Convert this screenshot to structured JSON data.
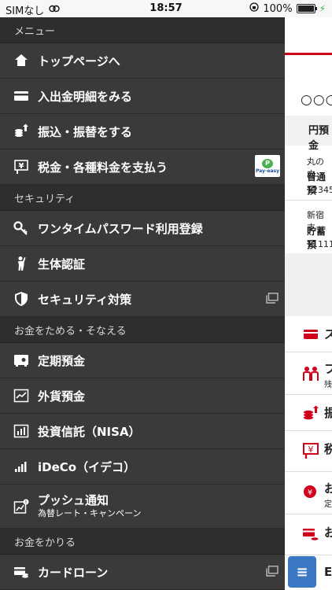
{
  "status": {
    "carrier": "SIMなし",
    "time": "18:57",
    "battery": "100%"
  },
  "menu": {
    "sections": [
      {
        "title": "メニュー",
        "items": [
          {
            "label": "トップページへ",
            "icon": "home-icon"
          },
          {
            "label": "入出金明細をみる",
            "icon": "card-icon"
          },
          {
            "label": "振込・振替をする",
            "icon": "coins-transfer-icon"
          },
          {
            "label": "税金・各種料金を支払う",
            "icon": "payment-slip-icon",
            "badge": "Pay-easy"
          }
        ]
      },
      {
        "title": "セキュリティ",
        "items": [
          {
            "label": "ワンタイムパスワード利用登録",
            "icon": "key-icon"
          },
          {
            "label": "生体認証",
            "icon": "person-icon"
          },
          {
            "label": "セキュリティ対策",
            "icon": "shield-icon",
            "external": true
          }
        ]
      },
      {
        "title": "お金をためる・そなえる",
        "items": [
          {
            "label": "定期預金",
            "icon": "safe-icon"
          },
          {
            "label": "外貨預金",
            "icon": "line-chart-icon"
          },
          {
            "label": "投資信託（NISA）",
            "icon": "bar-chart-icon"
          },
          {
            "label": "iDeCo（イデコ）",
            "icon": "signal-icon"
          },
          {
            "label": "プッシュ通知",
            "sub": "為替レート・キャンペーン",
            "icon": "notification-chart-icon"
          }
        ]
      },
      {
        "title": "お金をかりる",
        "items": [
          {
            "label": "カードローン",
            "icon": "loan-card-icon",
            "external": true
          }
        ]
      }
    ]
  },
  "content": {
    "header_dots": "○○○",
    "tab": "円預金",
    "accounts": [
      {
        "branch": "丸の内",
        "type": "普通預",
        "number": "12345"
      },
      {
        "branch": "新宿支",
        "type": "貯蓄預",
        "number": "11111"
      }
    ],
    "rows": [
      "ス",
      "フ",
      "振",
      "税",
      "お",
      "お",
      "E"
    ],
    "row_subs": [
      "",
      "残",
      "",
      "",
      "定",
      "",
      ""
    ]
  },
  "fab_label": "≡"
}
